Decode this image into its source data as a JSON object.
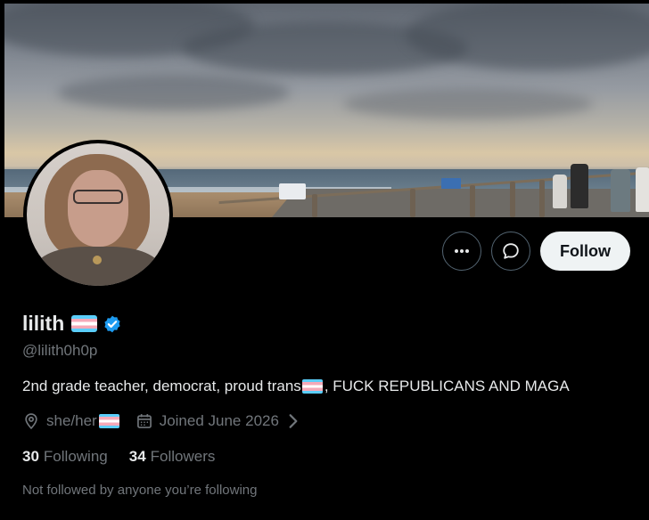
{
  "profile": {
    "display_name": "lilith",
    "handle": "@lilith0h0p",
    "bio_before_flag": "2nd grade teacher, democrat, proud trans",
    "bio_after_flag": ", FUCK REPUBLICANS AND MAGA",
    "pronouns": "she/her",
    "joined": "Joined June 2026",
    "following_count": "30",
    "following_label": "Following",
    "followers_count": "34",
    "followers_label": "Followers",
    "followed_by_note": "Not followed by anyone you’re following"
  },
  "actions": {
    "more_icon": "more-horizontal-icon",
    "message_icon": "chat-bubble-icon",
    "follow_label": "Follow"
  },
  "colors": {
    "background": "#000000",
    "primary_text": "#e7e9ea",
    "secondary_text": "#71767b",
    "verified": "#1d9bf0",
    "follow_button_bg": "#eff3f4"
  },
  "icons": {
    "verified": "verified-badge-icon",
    "location": "location-pin-icon",
    "calendar": "calendar-icon",
    "chevron": "chevron-right-icon",
    "flag": "trans-flag-emoji"
  }
}
